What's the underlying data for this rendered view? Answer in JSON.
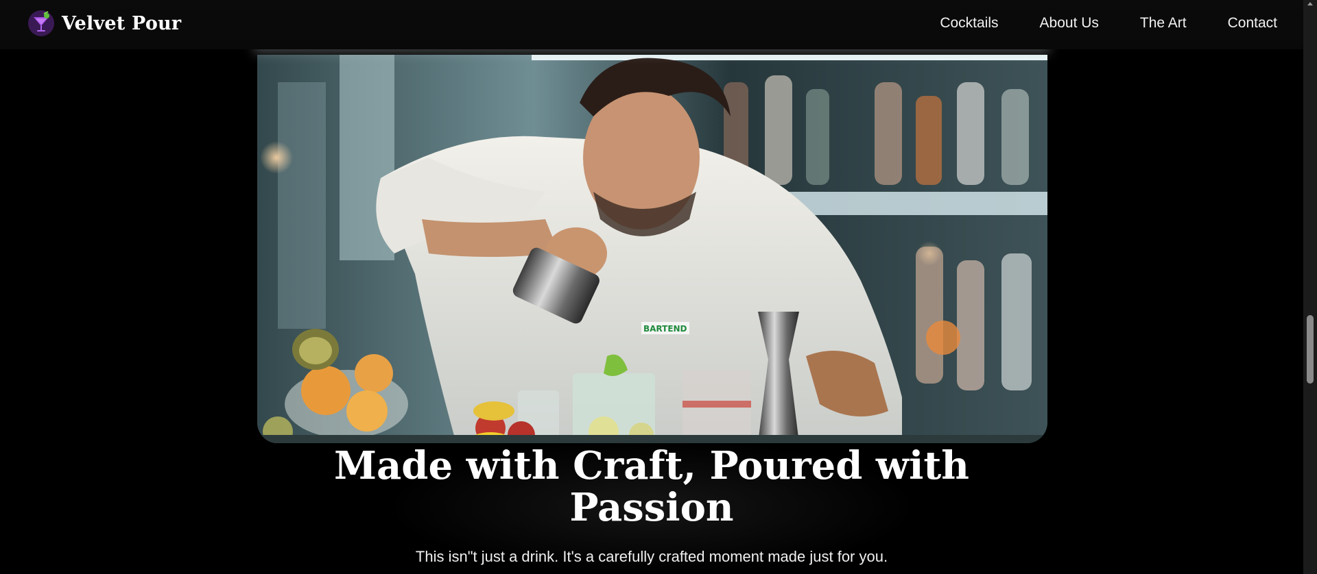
{
  "brand": {
    "name": "Velvet Pour",
    "icon": "cocktail-glass-icon"
  },
  "nav": {
    "links": [
      "Cocktails",
      "About Us",
      "The Art",
      "Contact"
    ]
  },
  "hero": {
    "image_description_icon": "bartender-photo",
    "heading": "Made with Craft, Poured with Passion",
    "subtext": "This isn\"t just a drink. It's a carefully crafted moment made just for you."
  },
  "colors": {
    "background": "#000000",
    "text": "#ffffff",
    "brand_accent": "#8b3fc7"
  }
}
